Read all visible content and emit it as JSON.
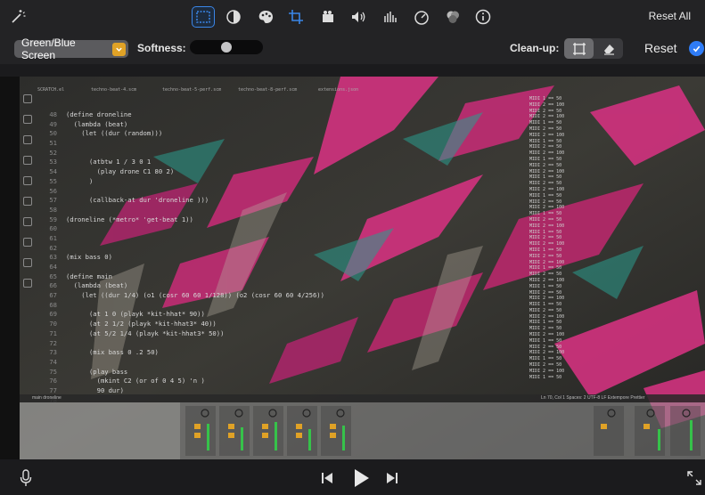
{
  "toolbar": {
    "reset_all_label": "Reset All",
    "icons": [
      "magic-wand-icon",
      "select-subject-icon",
      "exposure-icon",
      "palette-icon",
      "crop-icon",
      "camera-icon",
      "volume-icon",
      "equalizer-icon",
      "speed-icon",
      "overlay-icon",
      "info-icon"
    ]
  },
  "adjustments": {
    "mode_value": "Green/Blue Screen",
    "softness_label": "Softness:",
    "softness_value": 0.5,
    "cleanup_label": "Clean-up:",
    "reset_label": "Reset"
  },
  "screen": {
    "editor_tabs": [
      "SCRATCH.el",
      "techno-beat-4.scm",
      "techno-beat-5-perf.scm",
      "techno-beat-8-perf.scm",
      "extensions.json"
    ],
    "code_lines": [
      {
        "n": "48",
        "t": "(define droneline"
      },
      {
        "n": "49",
        "t": "  (lambda (beat)"
      },
      {
        "n": "50",
        "t": "    (let ((dur (random)))"
      },
      {
        "n": "51",
        "t": ""
      },
      {
        "n": "52",
        "t": ""
      },
      {
        "n": "53",
        "t": "      (atbtw 1 / 3 0 1"
      },
      {
        "n": "54",
        "t": "        (play drone C1 80 2)"
      },
      {
        "n": "55",
        "t": "      )"
      },
      {
        "n": "56",
        "t": ""
      },
      {
        "n": "57",
        "t": "      (callback-at dur 'droneline )))"
      },
      {
        "n": "58",
        "t": ""
      },
      {
        "n": "59",
        "t": "(droneline (*metro* 'get-beat 1))"
      },
      {
        "n": "60",
        "t": ""
      },
      {
        "n": "61",
        "t": ""
      },
      {
        "n": "62",
        "t": ""
      },
      {
        "n": "63",
        "t": "(mix bass 0)"
      },
      {
        "n": "64",
        "t": ""
      },
      {
        "n": "65",
        "t": "(define main"
      },
      {
        "n": "66",
        "t": "  (lambda (beat)"
      },
      {
        "n": "67",
        "t": "    (let ((dur 1/4) (o1 (cosr 60 60 1/128)) (o2 (cosr 60 60 4/256))"
      },
      {
        "n": "68",
        "t": ""
      },
      {
        "n": "69",
        "t": "      (at 1 0 (playk *kit-hhat* 90))"
      },
      {
        "n": "70",
        "t": "      (at 2 1/2 (playk *kit-hhat3* 40))"
      },
      {
        "n": "71",
        "t": "      (at 5/2 1/4 (playk *kit-hhat3* 50))"
      },
      {
        "n": "72",
        "t": ""
      },
      {
        "n": "73",
        "t": "      (mix bass 0 .2 50)"
      },
      {
        "n": "74",
        "t": ""
      },
      {
        "n": "75",
        "t": "      (play bass"
      },
      {
        "n": "76",
        "t": "        (mkint C2 (or of 0 4 5) 'n )"
      },
      {
        "n": "77",
        "t": "        90 dur)"
      },
      {
        "n": "78",
        "t": ""
      }
    ],
    "mixer_rows": [
      "MIDI 1 == 50",
      "MIDI 2 == 100",
      "MIDI 2 == 50",
      "MIDI 2 == 100",
      "MIDI 1 == 50",
      "MIDI 2 == 50",
      "MIDI 2 == 100",
      "MIDI 1 == 50",
      "MIDI 2 == 50",
      "MIDI 2 == 100",
      "MIDI 1 == 50",
      "MIDI 2 == 50",
      "MIDI 2 == 100",
      "MIDI 1 == 50",
      "MIDI 2 == 50",
      "MIDI 2 == 100",
      "MIDI 1 == 50",
      "MIDI 2 == 50",
      "MIDI 2 == 100",
      "MIDI 1 == 50",
      "MIDI 2 == 50",
      "MIDI 2 == 100",
      "MIDI 1 == 50",
      "MIDI 2 == 50",
      "MIDI 2 == 100",
      "MIDI 1 == 50",
      "MIDI 2 == 50",
      "MIDI 2 == 100",
      "MIDI 1 == 50",
      "MIDI 2 == 50",
      "MIDI 2 == 100",
      "MIDI 1 == 50",
      "MIDI 2 == 50",
      "MIDI 2 == 100",
      "MIDI 1 == 50",
      "MIDI 2 == 50",
      "MIDI 2 == 100",
      "MIDI 1 == 50",
      "MIDI 2 == 50",
      "MIDI 2 == 100",
      "MIDI 1 == 50",
      "MIDI 2 == 50",
      "MIDI 2 == 100",
      "MIDI 1 == 50",
      "MIDI 2 == 50",
      "MIDI 2 == 100",
      "MIDI 1 == 50"
    ],
    "status_left": "main  droneline",
    "status_right": "Ln 70, Col 1   Spaces: 2   UTF-8   LF   Extempore   Prettier",
    "colors": {
      "pink": "#d2327f",
      "teal": "#2a9c8e",
      "olive": "#4a4a40"
    }
  },
  "bottom": {
    "icons": [
      "microphone-icon",
      "skip-back-icon",
      "play-icon",
      "skip-forward-icon",
      "fullscreen-icon"
    ]
  }
}
